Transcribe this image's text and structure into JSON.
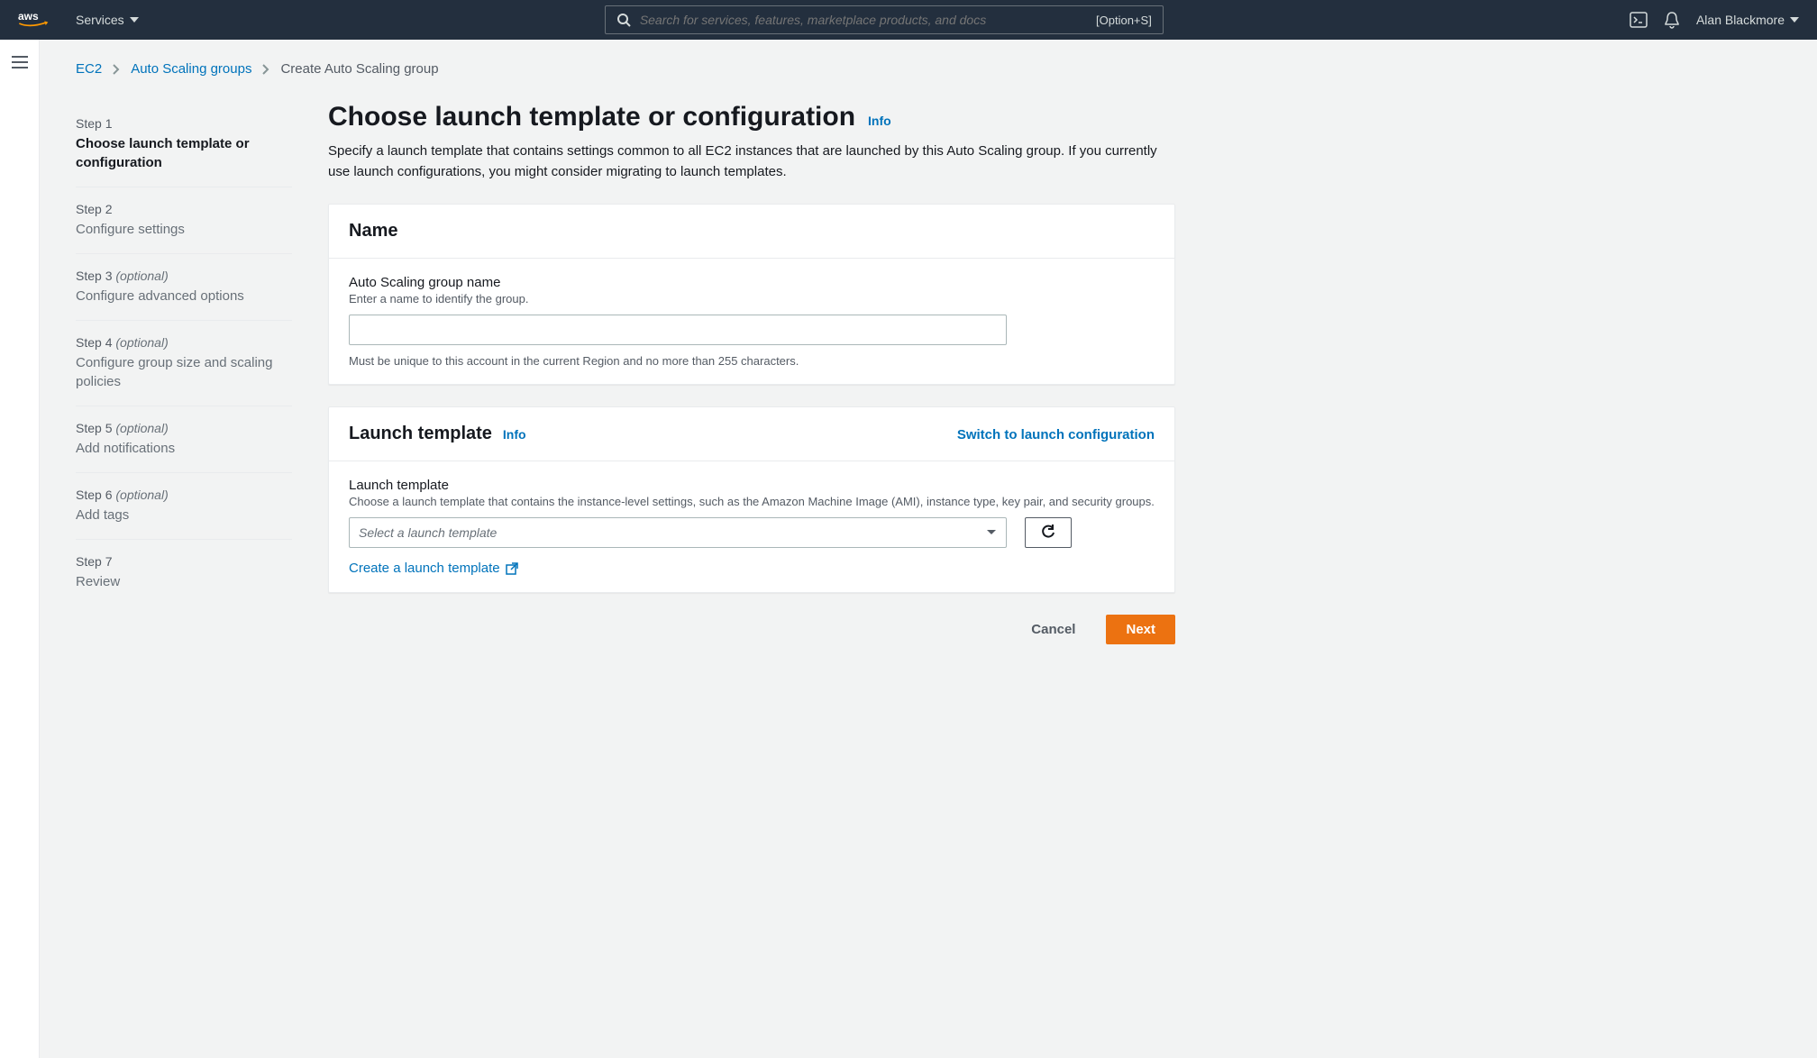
{
  "topnav": {
    "services_label": "Services",
    "search_placeholder": "Search for services, features, marketplace products, and docs",
    "search_shortcut": "[Option+S]",
    "username": "Alan Blackmore"
  },
  "breadcrumb": {
    "root": "EC2",
    "mid": "Auto Scaling groups",
    "current": "Create Auto Scaling group"
  },
  "steps": [
    {
      "label": "Step 1",
      "optional": "",
      "title": "Choose launch template or configuration",
      "active": true
    },
    {
      "label": "Step 2",
      "optional": "",
      "title": "Configure settings",
      "active": false
    },
    {
      "label": "Step 3",
      "optional": "(optional)",
      "title": "Configure advanced options",
      "active": false
    },
    {
      "label": "Step 4",
      "optional": "(optional)",
      "title": "Configure group size and scaling policies",
      "active": false
    },
    {
      "label": "Step 5",
      "optional": "(optional)",
      "title": "Add notifications",
      "active": false
    },
    {
      "label": "Step 6",
      "optional": "(optional)",
      "title": "Add tags",
      "active": false
    },
    {
      "label": "Step 7",
      "optional": "",
      "title": "Review",
      "active": false
    }
  ],
  "page": {
    "heading": "Choose launch template or configuration",
    "info": "Info",
    "description": "Specify a launch template that contains settings common to all EC2 instances that are launched by this Auto Scaling group. If you currently use launch configurations, you might consider migrating to launch templates."
  },
  "name_panel": {
    "title": "Name",
    "field_label": "Auto Scaling group name",
    "field_hint": "Enter a name to identify the group.",
    "field_value": "",
    "constraint": "Must be unique to this account in the current Region and no more than 255 characters."
  },
  "template_panel": {
    "title": "Launch template",
    "info": "Info",
    "switch_label": "Switch to launch configuration",
    "field_label": "Launch template",
    "field_hint": "Choose a launch template that contains the instance-level settings, such as the Amazon Machine Image (AMI), instance type, key pair, and security groups.",
    "select_placeholder": "Select a launch template",
    "create_link": "Create a launch template"
  },
  "footer": {
    "cancel": "Cancel",
    "next": "Next"
  },
  "colors": {
    "link": "#0073bb",
    "primary": "#ec7211",
    "navbg": "#232f3e"
  }
}
